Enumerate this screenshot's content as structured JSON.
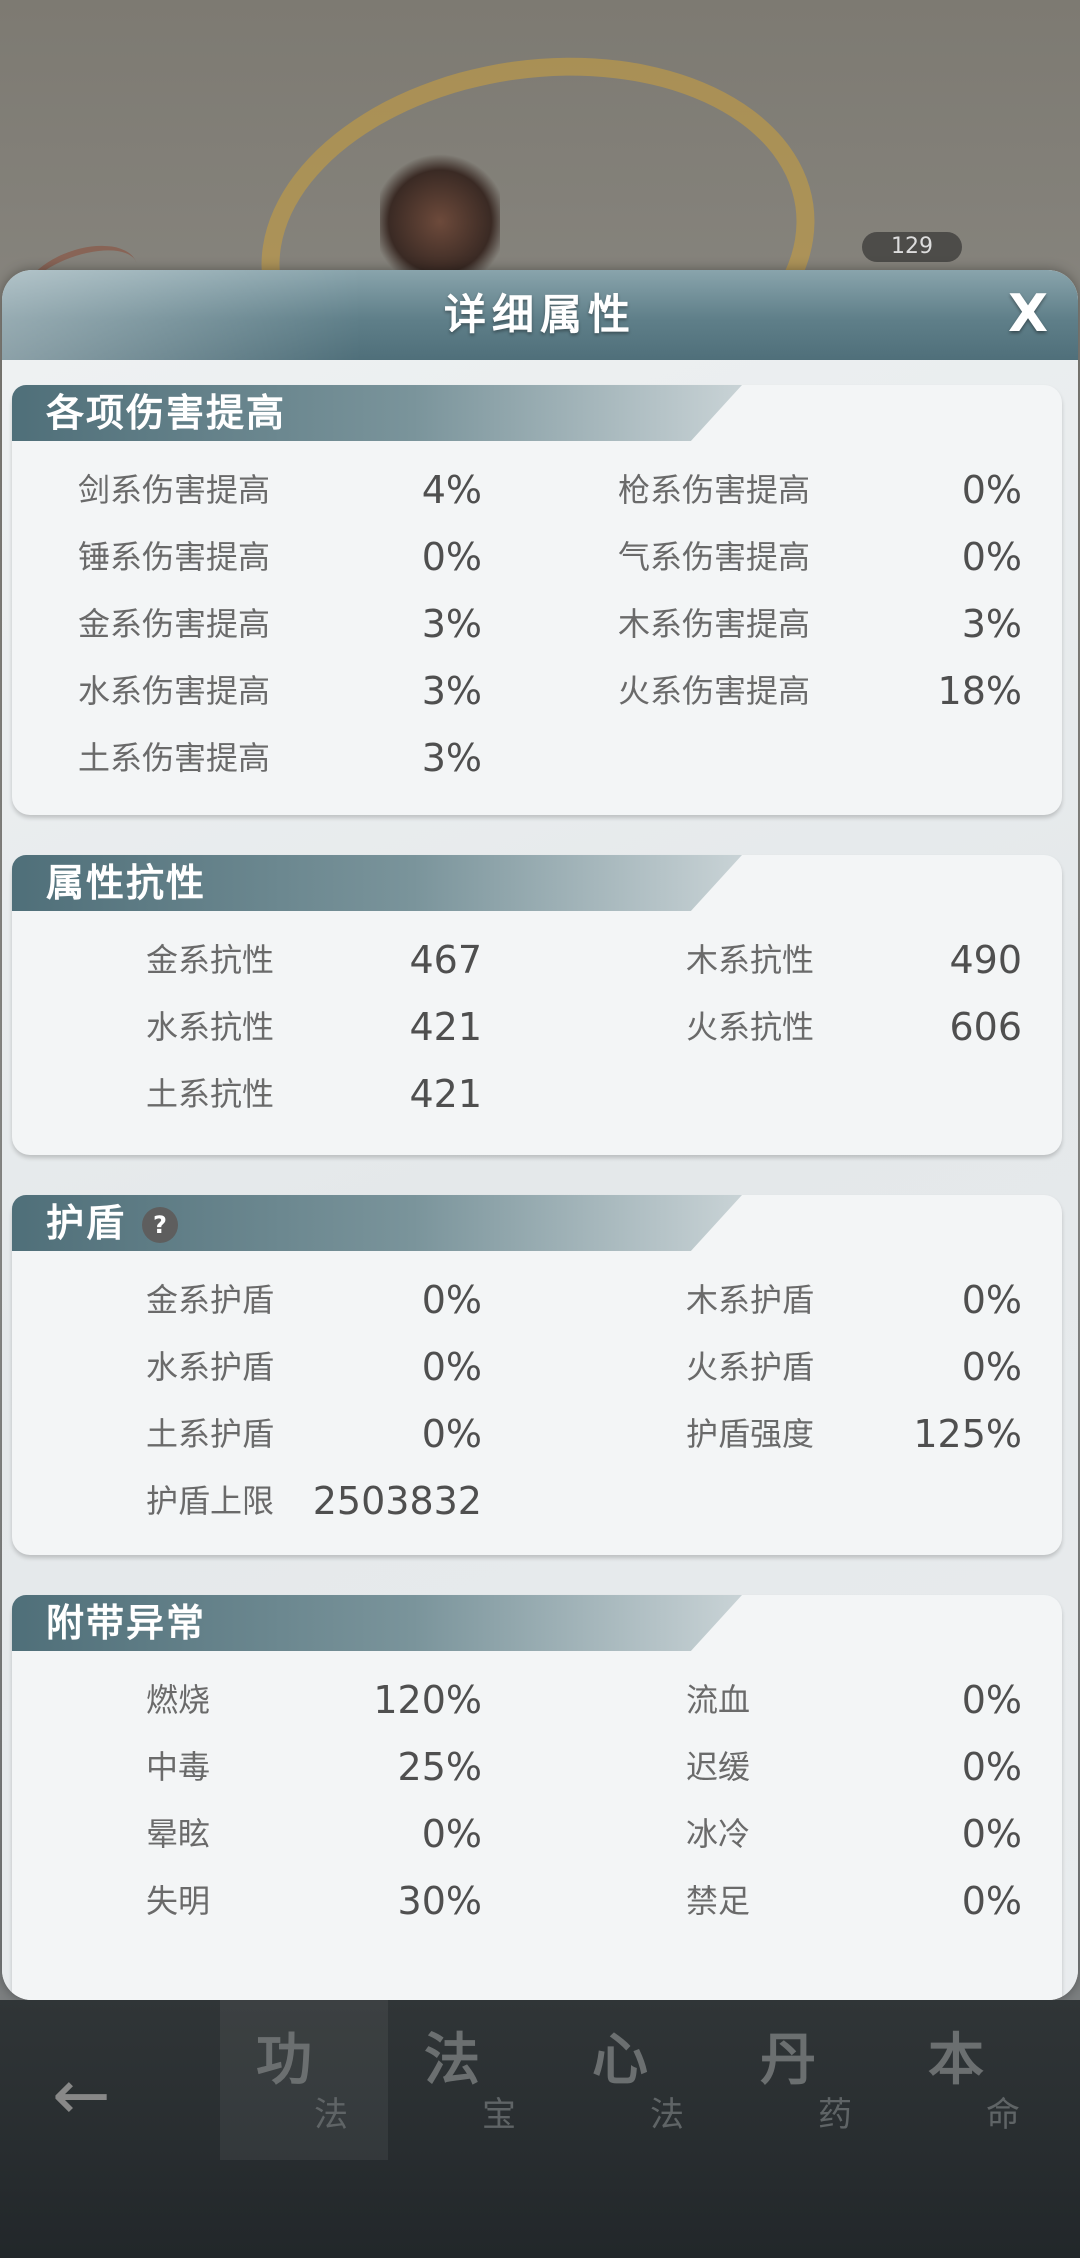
{
  "scene": {
    "level": "129"
  },
  "panel": {
    "title": "详细属性",
    "close_label": "X"
  },
  "sections": [
    {
      "title": "各项伤害提高",
      "rows": [
        {
          "left_label": "剑系伤害提高",
          "left_value": "4%",
          "right_label": "枪系伤害提高",
          "right_value": "0%"
        },
        {
          "left_label": "锤系伤害提高",
          "left_value": "0%",
          "right_label": "气系伤害提高",
          "right_value": "0%"
        },
        {
          "left_label": "金系伤害提高",
          "left_value": "3%",
          "right_label": "木系伤害提高",
          "right_value": "3%"
        },
        {
          "left_label": "水系伤害提高",
          "left_value": "3%",
          "right_label": "火系伤害提高",
          "right_value": "18%"
        },
        {
          "left_label": "土系伤害提高",
          "left_value": "3%",
          "right_label": "",
          "right_value": ""
        }
      ]
    },
    {
      "title": "属性抗性",
      "rows": [
        {
          "left_label": "金系抗性",
          "left_value": "467",
          "right_label": "木系抗性",
          "right_value": "490"
        },
        {
          "left_label": "水系抗性",
          "left_value": "421",
          "right_label": "火系抗性",
          "right_value": "606"
        },
        {
          "left_label": "土系抗性",
          "left_value": "421",
          "right_label": "",
          "right_value": ""
        }
      ]
    },
    {
      "title": "护盾",
      "help_icon": "?",
      "rows": [
        {
          "left_label": "金系护盾",
          "left_value": "0%",
          "right_label": "木系护盾",
          "right_value": "0%"
        },
        {
          "left_label": "水系护盾",
          "left_value": "0%",
          "right_label": "火系护盾",
          "right_value": "0%"
        },
        {
          "left_label": "土系护盾",
          "left_value": "0%",
          "right_label": "护盾强度",
          "right_value": "125%"
        },
        {
          "left_label": "护盾上限",
          "left_value": "2503832",
          "right_label": "",
          "right_value": ""
        }
      ]
    },
    {
      "title": "附带异常",
      "rows": [
        {
          "left_label": "燃烧",
          "left_value": "120%",
          "right_label": "流血",
          "right_value": "0%"
        },
        {
          "left_label": "中毒",
          "left_value": "25%",
          "right_label": "迟缓",
          "right_value": "0%"
        },
        {
          "left_label": "晕眩",
          "left_value": "0%",
          "right_label": "冰冷",
          "right_value": "0%"
        },
        {
          "left_label": "失明",
          "left_value": "30%",
          "right_label": "禁足",
          "right_value": "0%"
        }
      ]
    }
  ],
  "bottom_nav": {
    "back_icon": "arrow-left-icon",
    "tabs": [
      {
        "main": "功",
        "sub": "法"
      },
      {
        "main": "法",
        "sub": "宝"
      },
      {
        "main": "心",
        "sub": "法"
      },
      {
        "main": "丹",
        "sub": "药"
      },
      {
        "main": "本",
        "sub": "命"
      }
    ]
  }
}
